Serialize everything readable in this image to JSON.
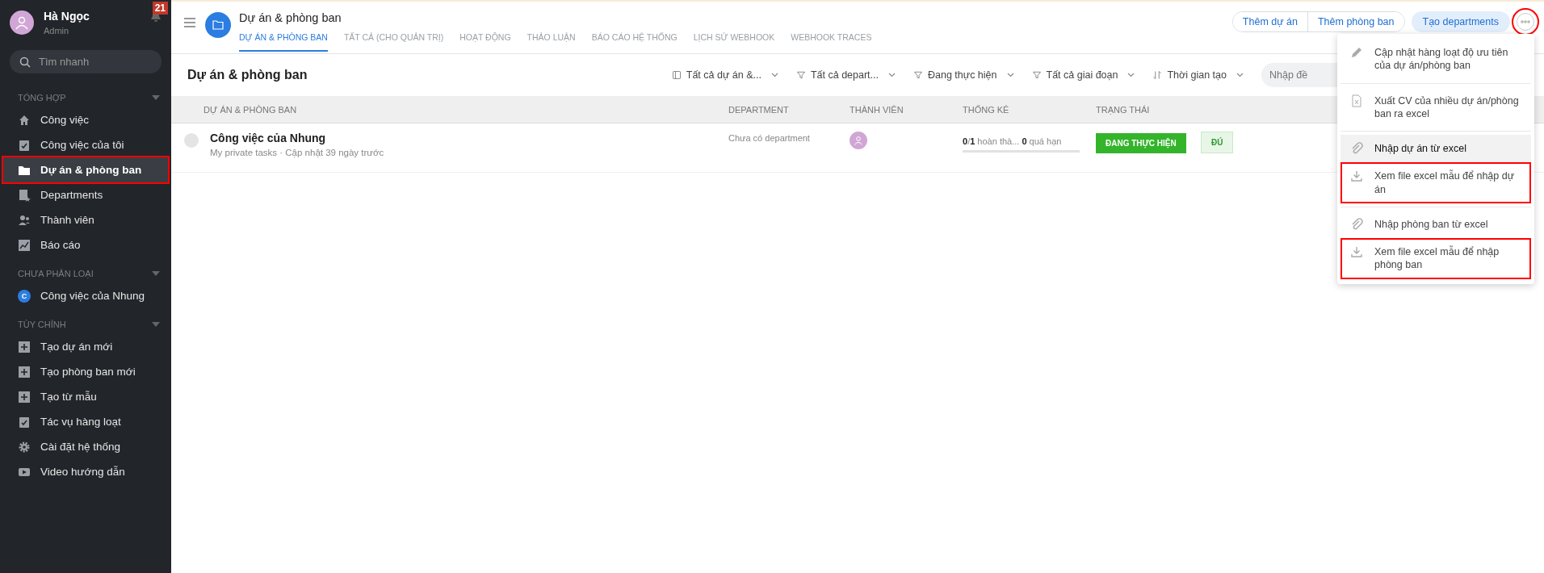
{
  "user": {
    "name": "Hà Ngọc",
    "role": "Admin"
  },
  "notifications": {
    "count": "21"
  },
  "search": {
    "placeholder": "Tìm nhanh"
  },
  "sidebar": {
    "sections": [
      {
        "title": "TỔNG HỢP",
        "items": [
          {
            "kind": "home",
            "label": "Công việc",
            "selected": false,
            "highlighted": false
          },
          {
            "kind": "clipboard",
            "label": "Công việc của tôi",
            "selected": false,
            "highlighted": false
          },
          {
            "kind": "folder",
            "label": "Dự án & phòng ban",
            "selected": true,
            "highlighted": true
          },
          {
            "kind": "document",
            "label": "Departments",
            "selected": false,
            "highlighted": false
          },
          {
            "kind": "people",
            "label": "Thành viên",
            "selected": false,
            "highlighted": false
          },
          {
            "kind": "chart",
            "label": "Báo cáo",
            "selected": false,
            "highlighted": false
          }
        ]
      },
      {
        "title": "CHƯA PHÂN LOẠI",
        "items": [
          {
            "kind": "letter",
            "badge": "C",
            "label": "Công việc của Nhung",
            "selected": false,
            "highlighted": false
          }
        ]
      },
      {
        "title": "TÙY CHỈNH",
        "items": [
          {
            "kind": "plus",
            "label": "Tạo dự án mới",
            "selected": false,
            "highlighted": false
          },
          {
            "kind": "plus",
            "label": "Tạo phòng ban mới",
            "selected": false,
            "highlighted": false
          },
          {
            "kind": "plus",
            "label": "Tạo từ mẫu",
            "selected": false,
            "highlighted": false
          },
          {
            "kind": "clipboard",
            "label": "Tác vụ hàng loạt",
            "selected": false,
            "highlighted": false
          },
          {
            "kind": "gear",
            "label": "Cài đặt hệ thống",
            "selected": false,
            "highlighted": false
          },
          {
            "kind": "video",
            "label": "Video hướng dẫn",
            "selected": false,
            "highlighted": false
          }
        ]
      }
    ]
  },
  "header": {
    "title": "Dự án & phòng ban",
    "tabs": [
      {
        "label": "DỰ ÁN & PHÒNG BAN",
        "selected": true
      },
      {
        "label": "TẤT CẢ (CHO QUẢN TRỊ)",
        "selected": false
      },
      {
        "label": "HOẠT ĐỘNG",
        "selected": false
      },
      {
        "label": "THẢO LUẬN",
        "selected": false
      },
      {
        "label": "BÁO CÁO HỆ THỐNG",
        "selected": false
      },
      {
        "label": "LỊCH SỬ WEBHOOK",
        "selected": false
      },
      {
        "label": "WEBHOOK TRACES",
        "selected": false
      }
    ],
    "buttons": [
      "Thêm dự án",
      "Thêm phòng ban"
    ],
    "primary_button": "Tạo departments",
    "more_button": {
      "highlighted": true
    }
  },
  "page_title": "Dự án & phòng ban",
  "filters": [
    {
      "kind": "panel",
      "label": "Tất cả dự án &..."
    },
    {
      "kind": "filter",
      "label": "Tất cả depart..."
    },
    {
      "kind": "filter",
      "label": "Đang thực hiện"
    },
    {
      "kind": "filter",
      "label": "Tất cả giai đoạn"
    },
    {
      "kind": "sort",
      "label": "Thời gian tạo"
    }
  ],
  "filter_search": {
    "placeholder": "Nhập đề"
  },
  "table": {
    "columns": [
      "DỰ ÁN & PHÒNG BAN",
      "DEPARTMENT",
      "THÀNH VIÊN",
      "THỐNG KÊ",
      "TRẠNG THÁI"
    ],
    "rows": [
      {
        "name": "Công việc của Nhung",
        "subtitle": "My private tasks · Cập nhật 39 ngày trước",
        "department": "Chưa có department",
        "stats": "**0**/**1** hoàn thà... **0** quá hạn",
        "level": 0,
        "status": "ĐANG THỰC HIỆN",
        "tag": "ĐÚ"
      }
    ]
  },
  "menu": {
    "groups": [
      [
        {
          "kind": "edit",
          "label": "Cập nhật hàng loạt độ ưu tiên của dự án/phòng ban",
          "selected": false,
          "highlighted": false
        }
      ],
      [
        {
          "kind": "excel",
          "label": "Xuất CV của nhiều dự án/phòng ban ra excel",
          "selected": false,
          "highlighted": false
        }
      ],
      [
        {
          "kind": "attach",
          "label": "Nhập dự án từ excel",
          "selected": true,
          "highlighted": false
        },
        {
          "kind": "download",
          "label": "Xem file excel mẫu để nhập dự án",
          "selected": false,
          "highlighted": true
        }
      ],
      [
        {
          "kind": "attach",
          "label": "Nhập phòng ban từ excel",
          "selected": false,
          "highlighted": false
        },
        {
          "kind": "download",
          "label": "Xem file excel mẫu để nhập phòng ban",
          "selected": false,
          "highlighted": true
        }
      ]
    ]
  }
}
